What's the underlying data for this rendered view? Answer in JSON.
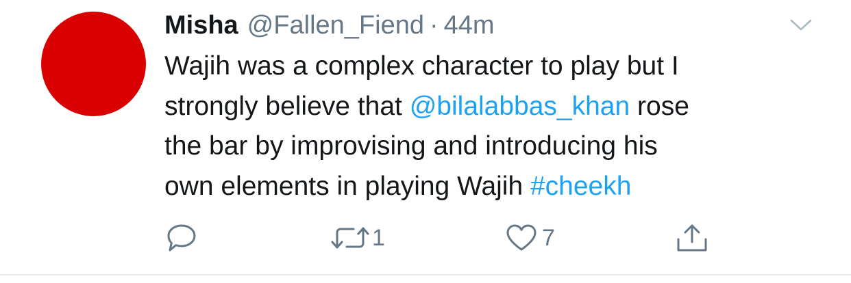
{
  "tweet": {
    "author": {
      "display_name": "Misha",
      "handle": "@Fallen_Fiend",
      "avatar_color": "#d80000"
    },
    "separator": "·",
    "timestamp": "44m",
    "text": {
      "line1": "Wajih was a complex character to play but I",
      "line2_before": "strongly believe that ",
      "mention": "@bilalabbas_khan",
      "line2_after": " rose",
      "line3": "the bar by improvising and introducing his",
      "line4_before": "own elements in playing Wajih ",
      "hashtag": "#cheekh"
    },
    "actions": {
      "reply": {
        "icon": "reply-icon",
        "count": ""
      },
      "retweet": {
        "icon": "retweet-icon",
        "count": "1"
      },
      "like": {
        "icon": "heart-icon",
        "count": "7"
      },
      "share": {
        "icon": "share-icon"
      }
    },
    "menu_icon": "chevron-down-icon"
  },
  "colors": {
    "link": "#1da1f2",
    "text": "#14171a",
    "secondary": "#657786",
    "divider": "#e6ecf0"
  }
}
